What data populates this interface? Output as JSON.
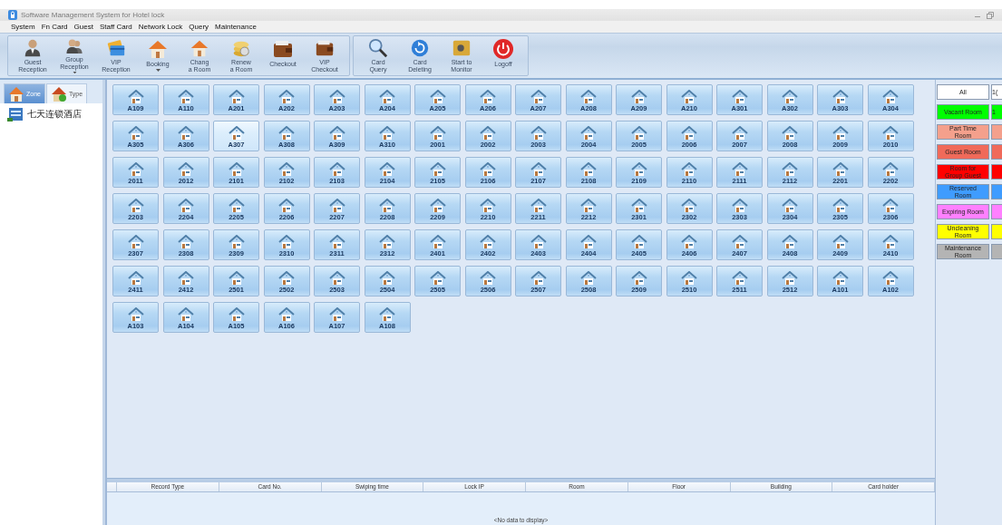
{
  "window": {
    "title": "Software Management System for Hotel lock"
  },
  "menu": [
    "System",
    "Fn Card",
    "Guest",
    "Staff Card",
    "Network Lock",
    "Query",
    "Maintenance"
  ],
  "toolbar_groups": [
    [
      {
        "label": "Guest\nReception",
        "kind": "person",
        "has_menu": false
      },
      {
        "label": "Group\nReception",
        "kind": "people",
        "has_menu": true
      },
      {
        "label": "VIP\nReception",
        "kind": "card",
        "has_menu": false
      },
      {
        "label": "Booking",
        "kind": "house",
        "has_menu": true
      },
      {
        "label": "Chang\na Room",
        "kind": "house",
        "has_menu": false
      },
      {
        "label": "Renew\na Room",
        "kind": "coins",
        "has_menu": false
      },
      {
        "label": "Checkout",
        "kind": "wallet",
        "has_menu": false
      },
      {
        "label": "VIP\nCheckout",
        "kind": "wallet",
        "has_menu": false
      }
    ],
    [
      {
        "label": "Card\nQuery",
        "kind": "magnifier",
        "has_menu": false
      },
      {
        "label": "Card\nDeleting",
        "kind": "refresh",
        "has_menu": false
      },
      {
        "label": "Start to\nMonitor",
        "kind": "safe",
        "has_menu": false
      },
      {
        "label": "Logoff",
        "kind": "power",
        "has_menu": false
      }
    ]
  ],
  "sidebar": {
    "tabs": [
      {
        "label": "Zone",
        "selected": true
      },
      {
        "label": "Type",
        "selected": false
      }
    ],
    "tree": [
      {
        "label": "七天连锁酒店"
      }
    ]
  },
  "rooms": [
    {
      "number": "A109",
      "selected": false
    },
    {
      "number": "A110",
      "selected": false
    },
    {
      "number": "A201",
      "selected": false
    },
    {
      "number": "A202",
      "selected": false
    },
    {
      "number": "A203",
      "selected": false
    },
    {
      "number": "A204",
      "selected": false
    },
    {
      "number": "A205",
      "selected": false
    },
    {
      "number": "A206",
      "selected": false
    },
    {
      "number": "A207",
      "selected": false
    },
    {
      "number": "A208",
      "selected": false
    },
    {
      "number": "A209",
      "selected": false
    },
    {
      "number": "A210",
      "selected": false
    },
    {
      "number": "A301",
      "selected": false
    },
    {
      "number": "A302",
      "selected": false
    },
    {
      "number": "A303",
      "selected": false
    },
    {
      "number": "A304",
      "selected": false
    },
    {
      "number": "A305",
      "selected": false
    },
    {
      "number": "A306",
      "selected": false
    },
    {
      "number": "A307",
      "selected": true
    },
    {
      "number": "A308",
      "selected": false
    },
    {
      "number": "A309",
      "selected": false
    },
    {
      "number": "A310",
      "selected": false
    },
    {
      "number": "2001",
      "selected": false
    },
    {
      "number": "2002",
      "selected": false
    },
    {
      "number": "2003",
      "selected": false
    },
    {
      "number": "2004",
      "selected": false
    },
    {
      "number": "2005",
      "selected": false
    },
    {
      "number": "2006",
      "selected": false
    },
    {
      "number": "2007",
      "selected": false
    },
    {
      "number": "2008",
      "selected": false
    },
    {
      "number": "2009",
      "selected": false
    },
    {
      "number": "2010",
      "selected": false
    },
    {
      "number": "2011",
      "selected": false
    },
    {
      "number": "2012",
      "selected": false
    },
    {
      "number": "2101",
      "selected": false
    },
    {
      "number": "2102",
      "selected": false
    },
    {
      "number": "2103",
      "selected": false
    },
    {
      "number": "2104",
      "selected": false
    },
    {
      "number": "2105",
      "selected": false
    },
    {
      "number": "2106",
      "selected": false
    },
    {
      "number": "2107",
      "selected": false
    },
    {
      "number": "2108",
      "selected": false
    },
    {
      "number": "2109",
      "selected": false
    },
    {
      "number": "2110",
      "selected": false
    },
    {
      "number": "2111",
      "selected": false
    },
    {
      "number": "2112",
      "selected": false
    },
    {
      "number": "2201",
      "selected": false
    },
    {
      "number": "2202",
      "selected": false
    },
    {
      "number": "2203",
      "selected": false
    },
    {
      "number": "2204",
      "selected": false
    },
    {
      "number": "2205",
      "selected": false
    },
    {
      "number": "2206",
      "selected": false
    },
    {
      "number": "2207",
      "selected": false
    },
    {
      "number": "2208",
      "selected": false
    },
    {
      "number": "2209",
      "selected": false
    },
    {
      "number": "2210",
      "selected": false
    },
    {
      "number": "2211",
      "selected": false
    },
    {
      "number": "2212",
      "selected": false
    },
    {
      "number": "2301",
      "selected": false
    },
    {
      "number": "2302",
      "selected": false
    },
    {
      "number": "2303",
      "selected": false
    },
    {
      "number": "2304",
      "selected": false
    },
    {
      "number": "2305",
      "selected": false
    },
    {
      "number": "2306",
      "selected": false
    },
    {
      "number": "2307",
      "selected": false
    },
    {
      "number": "2308",
      "selected": false
    },
    {
      "number": "2309",
      "selected": false
    },
    {
      "number": "2310",
      "selected": false
    },
    {
      "number": "2311",
      "selected": false
    },
    {
      "number": "2312",
      "selected": false
    },
    {
      "number": "2401",
      "selected": false
    },
    {
      "number": "2402",
      "selected": false
    },
    {
      "number": "2403",
      "selected": false
    },
    {
      "number": "2404",
      "selected": false
    },
    {
      "number": "2405",
      "selected": false
    },
    {
      "number": "2406",
      "selected": false
    },
    {
      "number": "2407",
      "selected": false
    },
    {
      "number": "2408",
      "selected": false
    },
    {
      "number": "2409",
      "selected": false
    },
    {
      "number": "2410",
      "selected": false
    },
    {
      "number": "2411",
      "selected": false
    },
    {
      "number": "2412",
      "selected": false
    },
    {
      "number": "2501",
      "selected": false
    },
    {
      "number": "2502",
      "selected": false
    },
    {
      "number": "2503",
      "selected": false
    },
    {
      "number": "2504",
      "selected": false
    },
    {
      "number": "2505",
      "selected": false
    },
    {
      "number": "2506",
      "selected": false
    },
    {
      "number": "2507",
      "selected": false
    },
    {
      "number": "2508",
      "selected": false
    },
    {
      "number": "2509",
      "selected": false
    },
    {
      "number": "2510",
      "selected": false
    },
    {
      "number": "2511",
      "selected": false
    },
    {
      "number": "2512",
      "selected": false
    },
    {
      "number": "A101",
      "selected": false
    },
    {
      "number": "A102",
      "selected": false
    },
    {
      "number": "A103",
      "selected": false
    },
    {
      "number": "A104",
      "selected": false
    },
    {
      "number": "A105",
      "selected": false
    },
    {
      "number": "A106",
      "selected": false
    },
    {
      "number": "A107",
      "selected": false
    },
    {
      "number": "A108",
      "selected": false
    }
  ],
  "legend": [
    {
      "label": "All",
      "count": "1(",
      "color": "#ffffff"
    },
    {
      "label": "Vacant Room",
      "count": "1",
      "color": "#00ff00"
    },
    {
      "label": "Part Time\nRoom",
      "color": "#f4a08c"
    },
    {
      "label": "Guest Room",
      "color": "#f06a5a"
    },
    {
      "label": "Room for\nGroup Guest",
      "color": "#ff0000"
    },
    {
      "label": "Reserved\nRoom",
      "color": "#3f9cff"
    },
    {
      "label": "Expiring Room",
      "color": "#ff80ff"
    },
    {
      "label": "Uncleaning\nRoom",
      "color": "#ffff00"
    },
    {
      "label": "Maintenance\nRoom",
      "color": "#b4b4b4"
    }
  ],
  "table": {
    "columns": [
      "",
      "Record Type",
      "Card No.",
      "Swiping time",
      "Lock IP",
      "Room",
      "Floor",
      "Building",
      "Card holder"
    ],
    "empty_text": "<No data to display>"
  }
}
